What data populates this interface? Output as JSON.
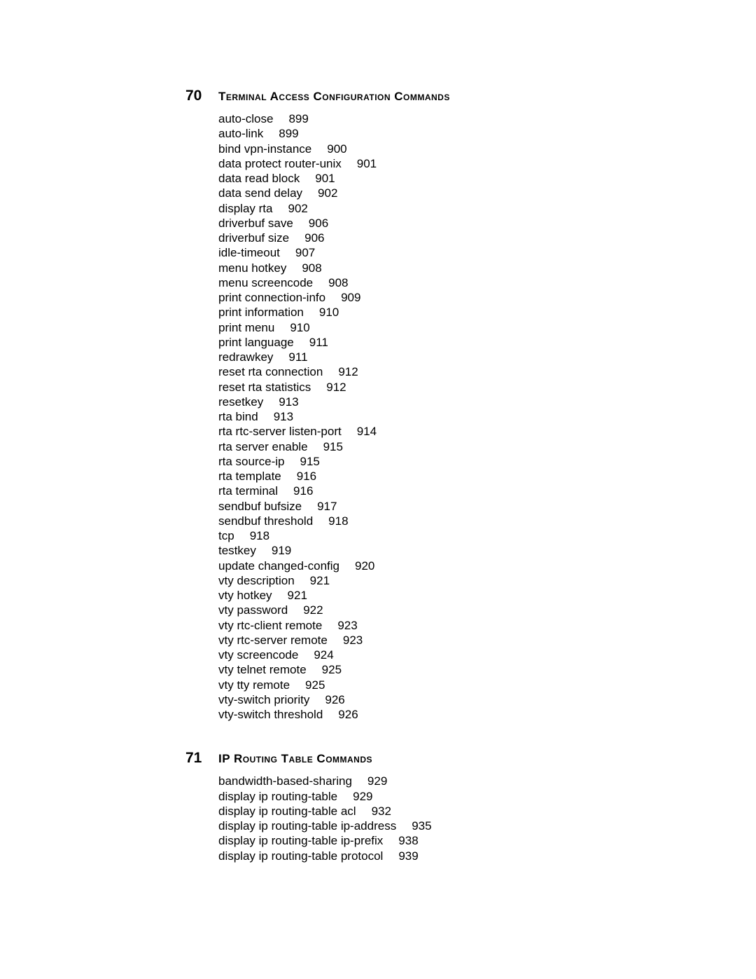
{
  "sections": [
    {
      "number": "70",
      "title": "Terminal Access Configuration Commands",
      "entries": [
        {
          "cmd": "auto-close",
          "page": "899"
        },
        {
          "cmd": "auto-link",
          "page": "899"
        },
        {
          "cmd": "bind vpn-instance",
          "page": "900"
        },
        {
          "cmd": "data protect router-unix",
          "page": "901"
        },
        {
          "cmd": "data read block",
          "page": "901"
        },
        {
          "cmd": "data send delay",
          "page": "902"
        },
        {
          "cmd": "display rta",
          "page": "902"
        },
        {
          "cmd": "driverbuf save",
          "page": "906"
        },
        {
          "cmd": "driverbuf size",
          "page": "906"
        },
        {
          "cmd": "idle-timeout",
          "page": "907"
        },
        {
          "cmd": "menu hotkey",
          "page": "908"
        },
        {
          "cmd": "menu screencode",
          "page": "908"
        },
        {
          "cmd": "print connection-info",
          "page": "909"
        },
        {
          "cmd": "print information",
          "page": "910"
        },
        {
          "cmd": "print menu",
          "page": "910"
        },
        {
          "cmd": "print language",
          "page": "911"
        },
        {
          "cmd": "redrawkey",
          "page": "911"
        },
        {
          "cmd": "reset rta connection",
          "page": "912"
        },
        {
          "cmd": "reset rta statistics",
          "page": "912"
        },
        {
          "cmd": "resetkey",
          "page": "913"
        },
        {
          "cmd": "rta bind",
          "page": "913"
        },
        {
          "cmd": "rta rtc-server listen-port",
          "page": "914"
        },
        {
          "cmd": "rta server enable",
          "page": "915"
        },
        {
          "cmd": "rta source-ip",
          "page": "915"
        },
        {
          "cmd": "rta template",
          "page": "916"
        },
        {
          "cmd": "rta terminal",
          "page": "916"
        },
        {
          "cmd": "sendbuf bufsize",
          "page": "917"
        },
        {
          "cmd": "sendbuf threshold",
          "page": "918"
        },
        {
          "cmd": "tcp",
          "page": "918"
        },
        {
          "cmd": "testkey",
          "page": "919"
        },
        {
          "cmd": "update changed-config",
          "page": "920"
        },
        {
          "cmd": "vty description",
          "page": "921"
        },
        {
          "cmd": "vty hotkey",
          "page": "921"
        },
        {
          "cmd": "vty password",
          "page": "922"
        },
        {
          "cmd": "vty rtc-client remote",
          "page": "923"
        },
        {
          "cmd": "vty rtc-server remote",
          "page": "923"
        },
        {
          "cmd": "vty screencode",
          "page": "924"
        },
        {
          "cmd": "vty telnet remote",
          "page": "925"
        },
        {
          "cmd": "vty tty remote",
          "page": "925"
        },
        {
          "cmd": "vty-switch priority",
          "page": "926"
        },
        {
          "cmd": "vty-switch threshold",
          "page": "926"
        }
      ]
    },
    {
      "number": "71",
      "title": "IP Routing Table Commands",
      "entries": [
        {
          "cmd": "bandwidth-based-sharing",
          "page": "929"
        },
        {
          "cmd": "display ip routing-table",
          "page": "929"
        },
        {
          "cmd": "display ip routing-table acl",
          "page": "932"
        },
        {
          "cmd": "display ip routing-table ip-address",
          "page": "935"
        },
        {
          "cmd": "display ip routing-table ip-prefix",
          "page": "938"
        },
        {
          "cmd": "display ip routing-table protocol",
          "page": "939"
        }
      ]
    }
  ]
}
